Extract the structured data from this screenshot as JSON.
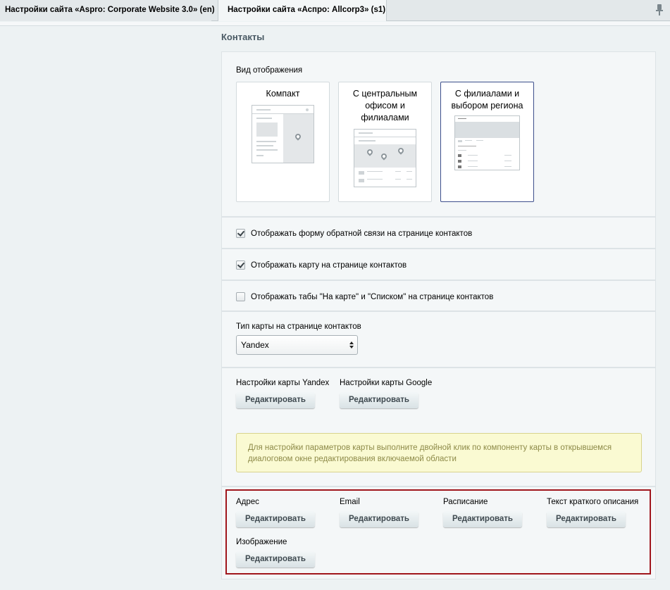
{
  "tabs": [
    {
      "label": "Настройки сайта «Aspro: Corporate Website 3.0» (en)",
      "active": true
    },
    {
      "label": "Настройки сайта «Аспро: Allcorp3» (s1)",
      "active": false
    }
  ],
  "section": {
    "title": "Контакты"
  },
  "view": {
    "label": "Вид отображения",
    "options": [
      {
        "title": "Компакт",
        "selected": false
      },
      {
        "title": "С центральным офисом и филиалами",
        "selected": false
      },
      {
        "title": "С филиалами и выбором региона",
        "selected": true
      }
    ]
  },
  "checkboxes": [
    {
      "label": "Отображать форму обратной связи на странице контактов",
      "checked": true
    },
    {
      "label": "Отображать карту на странице контактов",
      "checked": true
    },
    {
      "label": "Отображать табы \"На карте\" и \"Списком\" на странице контактов",
      "checked": false
    }
  ],
  "map_type": {
    "label": "Тип карты на странице контактов",
    "value": "Yandex"
  },
  "map_settings": {
    "yandex_label": "Настройки карты Yandex",
    "google_label": "Настройки карты Google",
    "edit_label": "Редактировать",
    "note": "Для настройки параметров карты выполните двойной клик по компоненту карты в открывшемся диалоговом окне редактирования включаемой области"
  },
  "fields": {
    "address": "Адрес",
    "email": "Email",
    "schedule": "Расписание",
    "description": "Текст краткого описания",
    "image": "Изображение",
    "edit_label": "Редактировать"
  }
}
